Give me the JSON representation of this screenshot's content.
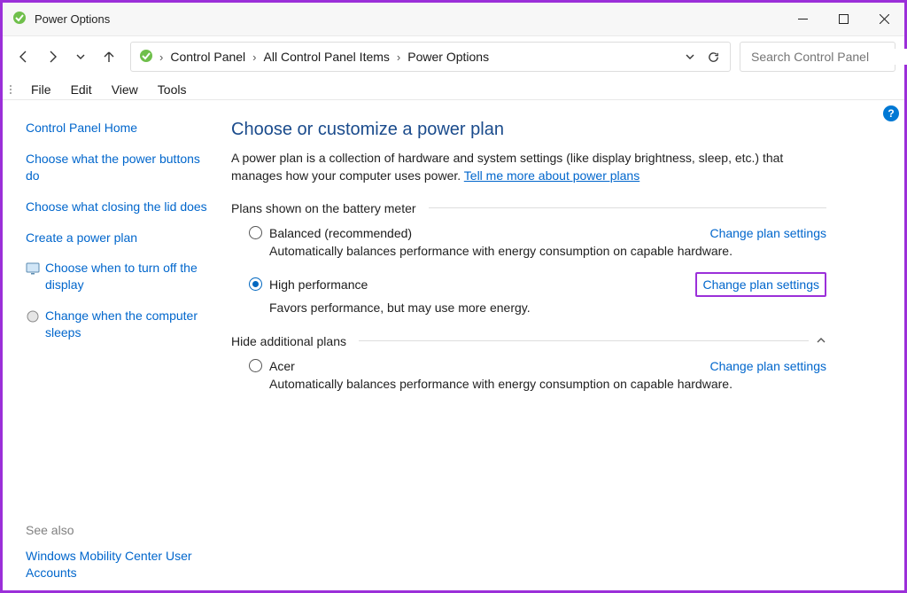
{
  "window": {
    "title": "Power Options"
  },
  "breadcrumbs": {
    "c0": "Control Panel",
    "c1": "All Control Panel Items",
    "c2": "Power Options"
  },
  "search": {
    "placeholder": "Search Control Panel"
  },
  "menu": {
    "file": "File",
    "edit": "Edit",
    "view": "View",
    "tools": "Tools"
  },
  "sidebar": {
    "home": "Control Panel Home",
    "s0": "Choose what the power buttons do",
    "s1": "Choose what closing the lid does",
    "s2": "Create a power plan",
    "s3": "Choose when to turn off the display",
    "s4": "Change when the computer sleeps"
  },
  "seealso": {
    "header": "See also",
    "l0": "Windows Mobility Center",
    "l1": "User Accounts"
  },
  "main": {
    "title": "Choose or customize a power plan",
    "desc1": "A power plan is a collection of hardware and system settings (like display brightness, sleep, etc.) that manages how your computer uses power. ",
    "descLink": "Tell me more about power plans",
    "sec1": "Plans shown on the battery meter",
    "sec2": "Hide additional plans",
    "changeLink": "Change plan settings",
    "plans": {
      "p0": {
        "name": "Balanced (recommended)",
        "desc": "Automatically balances performance with energy consumption on capable hardware."
      },
      "p1": {
        "name": "High performance",
        "desc": "Favors performance, but may use more energy."
      },
      "p2": {
        "name": "Acer",
        "desc": "Automatically balances performance with energy consumption on capable hardware."
      }
    }
  },
  "help": "?"
}
